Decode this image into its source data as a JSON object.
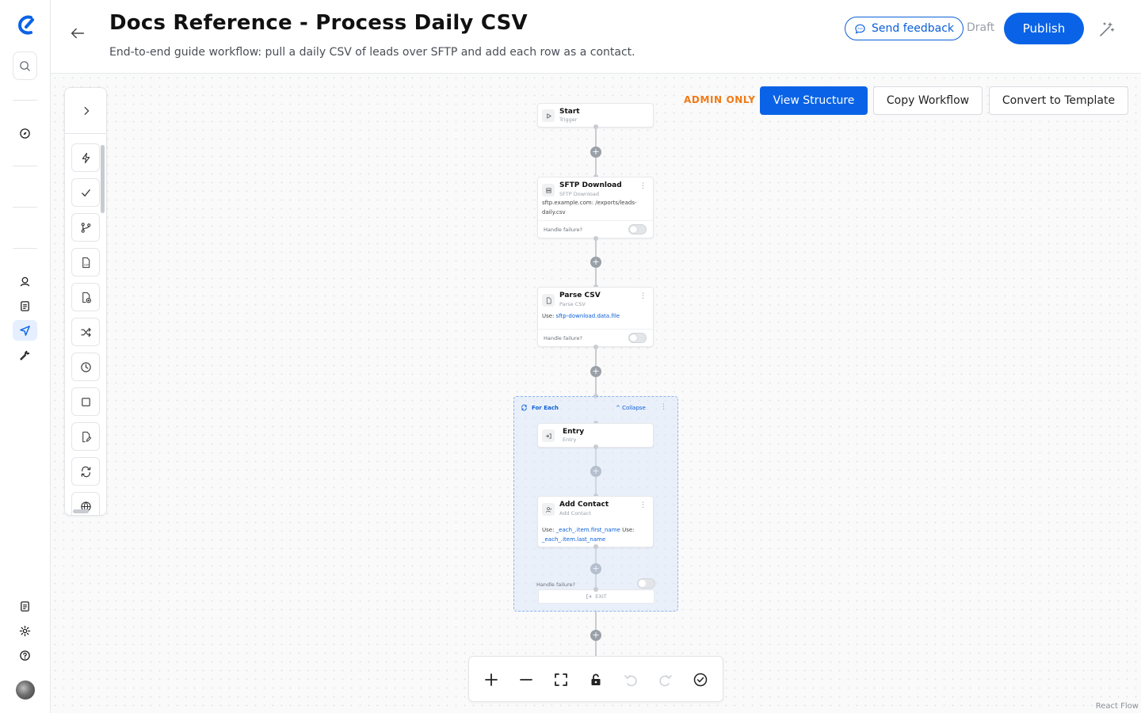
{
  "header": {
    "title": "Docs Reference - Process Daily CSV",
    "subtitle": "End-to-end guide workflow: pull a daily CSV of leads over SFTP and add each row as a contact.",
    "feedback_label": "Send feedback",
    "status": "Draft",
    "publish_label": "Publish"
  },
  "admin": {
    "label": "ADMIN ONLY",
    "view_structure": "View Structure",
    "copy_workflow": "Copy Workflow",
    "convert_template": "Convert to Template"
  },
  "nodes": {
    "start": {
      "title": "Start",
      "subtitle": "Trigger"
    },
    "sftp": {
      "title": "SFTP Download",
      "subtitle": "SFTP Download",
      "body": "sftp.example.com: /exports/leads-daily.csv",
      "fail_label": "Handle failure?"
    },
    "parse": {
      "title": "Parse CSV",
      "subtitle": "Parse CSV",
      "use_label": "Use:",
      "use_ref": "sftp-download.data.file",
      "fail_label": "Handle failure?"
    },
    "foreach": {
      "title": "For Each",
      "collapse_label": "Collapse",
      "fail_label": "Handle failure?",
      "exit_label": "EXIT"
    },
    "entry": {
      "title": "Entry",
      "subtitle": "Entry"
    },
    "contact": {
      "title": "Add Contact",
      "subtitle": "Add Contact",
      "use_label_1": "Use:",
      "use_ref_1": "_each_.item.first_name",
      "use_label_2": "Use:",
      "use_ref_2": "_each_.item.last_name"
    }
  },
  "attribution": "React Flow",
  "colors": {
    "accent": "#0a63e6",
    "admin": "#f07a16",
    "group_border": "#8db3ef"
  }
}
